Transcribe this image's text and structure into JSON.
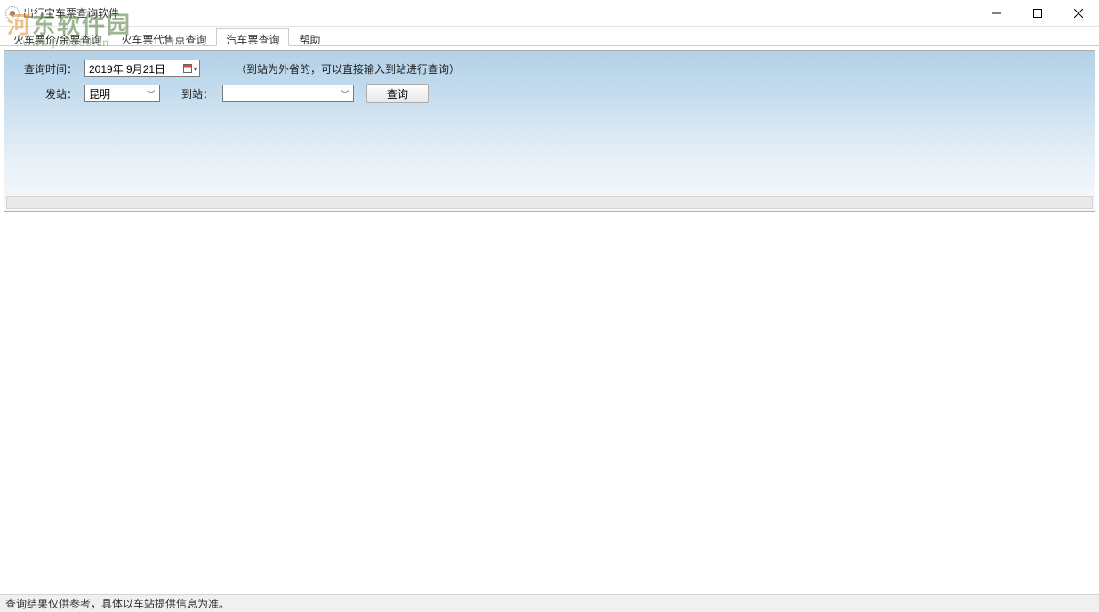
{
  "window": {
    "title": "出行宝车票查询软件"
  },
  "tabs": {
    "items": [
      {
        "label": "火车票价/余票查询"
      },
      {
        "label": "火车票代售点查询"
      },
      {
        "label": "汽车票查询"
      },
      {
        "label": "帮助"
      }
    ],
    "active_index": 2
  },
  "form": {
    "query_time_label": "查询时间：",
    "query_time_value": "2019年 9月21日",
    "hint": "（到站为外省的，可以直接输入到站进行查询）",
    "from_label": "发站：",
    "from_value": "昆明",
    "to_label": "到站：",
    "to_value": "",
    "search_button": "查询"
  },
  "statusbar": {
    "text": "查询结果仅供参考，具体以车站提供信息为准。"
  },
  "watermark": {
    "line1_a": "河",
    "line1_b": "东软件园",
    "line2": "www.pc0359.cn"
  }
}
